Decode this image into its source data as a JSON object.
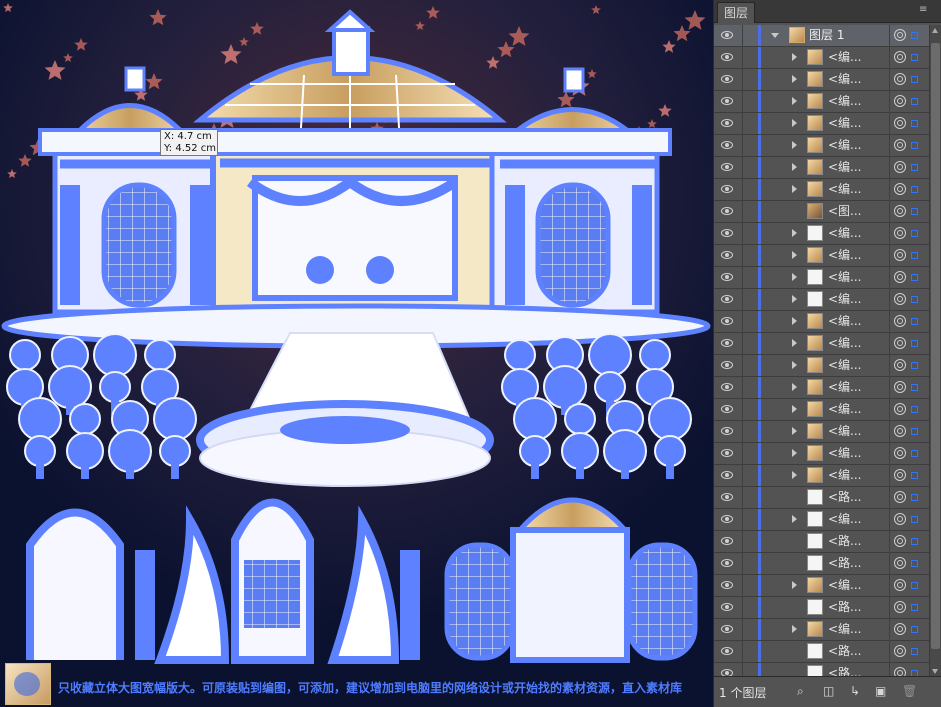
{
  "canvas": {
    "tooltip": {
      "x": "X: 4.7 cm",
      "y": "Y: 4.52 cm"
    },
    "caption": "只收藏立体大图宽幅版大。可原装贴到编图，可添加，建议增加到电脑里的网络设计或开始找的素材资源，直入素材库"
  },
  "panel": {
    "tab": "图层",
    "menu_icon": "≡",
    "top_layer": "图层 1",
    "rows": [
      {
        "name": "<编...",
        "expand": true,
        "thumb": "gold"
      },
      {
        "name": "<编...",
        "expand": true,
        "thumb": "gold"
      },
      {
        "name": "<编...",
        "expand": true,
        "thumb": "gold"
      },
      {
        "name": "<编...",
        "expand": true,
        "thumb": "gold"
      },
      {
        "name": "<编...",
        "expand": true,
        "thumb": "gold"
      },
      {
        "name": "<编...",
        "expand": true,
        "thumb": "gold"
      },
      {
        "name": "<编...",
        "expand": true,
        "thumb": "gold"
      },
      {
        "name": "<图...",
        "expand": false,
        "thumb": "cupid"
      },
      {
        "name": "<编...",
        "expand": true,
        "thumb": "white"
      },
      {
        "name": "<编...",
        "expand": true,
        "thumb": "gold"
      },
      {
        "name": "<编...",
        "expand": true,
        "thumb": "white"
      },
      {
        "name": "<编...",
        "expand": true,
        "thumb": "white"
      },
      {
        "name": "<编...",
        "expand": true,
        "thumb": "gold"
      },
      {
        "name": "<编...",
        "expand": true,
        "thumb": "gold"
      },
      {
        "name": "<编...",
        "expand": true,
        "thumb": "gold"
      },
      {
        "name": "<编...",
        "expand": true,
        "thumb": "gold"
      },
      {
        "name": "<编...",
        "expand": true,
        "thumb": "gold"
      },
      {
        "name": "<编...",
        "expand": true,
        "thumb": "gold"
      },
      {
        "name": "<编...",
        "expand": true,
        "thumb": "gold"
      },
      {
        "name": "<编...",
        "expand": true,
        "thumb": "gold"
      },
      {
        "name": "<路...",
        "expand": false,
        "thumb": "white"
      },
      {
        "name": "<编...",
        "expand": true,
        "thumb": "white"
      },
      {
        "name": "<路...",
        "expand": false,
        "thumb": "white"
      },
      {
        "name": "<路...",
        "expand": false,
        "thumb": "white"
      },
      {
        "name": "<编...",
        "expand": true,
        "thumb": "gold"
      },
      {
        "name": "<路...",
        "expand": false,
        "thumb": "white"
      },
      {
        "name": "<编...",
        "expand": true,
        "thumb": "gold"
      },
      {
        "name": "<路...",
        "expand": false,
        "thumb": "white"
      },
      {
        "name": "<路...",
        "expand": false,
        "thumb": "white"
      },
      {
        "name": "<路...",
        "expand": false,
        "thumb": "white"
      }
    ],
    "footer": {
      "count": "1 个图层"
    }
  },
  "colors": {
    "selection": "#4b6fe6",
    "panel_bg": "#535353",
    "canvas_bg": "#101734",
    "gold": "#d7b46f"
  }
}
